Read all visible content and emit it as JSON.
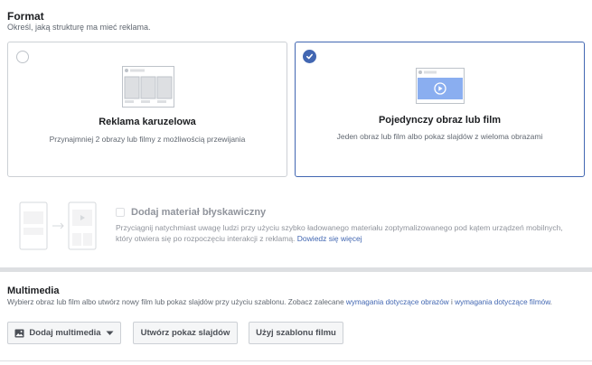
{
  "format": {
    "title": "Format",
    "subtitle": "Określ, jaką strukturę ma mieć reklama.",
    "options": [
      {
        "title": "Reklama karuzelowa",
        "description": "Przynajmniej 2 obrazy lub filmy z możliwością przewijania",
        "selected": false
      },
      {
        "title": "Pojedynczy obraz lub film",
        "description": "Jeden obraz lub film albo pokaz slajdów z wieloma obrazami",
        "selected": true
      }
    ]
  },
  "instant_experience": {
    "title": "Dodaj materiał błyskawiczny",
    "description": "Przyciągnij natychmiast uwagę ludzi przy użyciu szybko ładowanego materiału zoptymalizowanego pod kątem urządzeń mobilnych, który otwiera się po rozpoczęciu interakcji z reklamą.",
    "link": "Dowiedz się więcej",
    "enabled": false
  },
  "media": {
    "title": "Multimedia",
    "subtitle_prefix": "Wybierz obraz lub film albo utwórz nowy film lub pokaz slajdów przy użyciu szablonu. Zobacz zalecane",
    "link_images": "wymagania dotyczące obrazów",
    "and": "i",
    "link_videos": "wymagania dotyczące filmów",
    "period": ".",
    "buttons": {
      "add_media": "Dodaj multimedia",
      "slideshow": "Utwórz pokaz slajdów",
      "template": "Użyj szablonu filmu"
    }
  },
  "colors": {
    "accent": "#4267b2",
    "border": "#ccd0d5",
    "muted_text": "#606770"
  }
}
